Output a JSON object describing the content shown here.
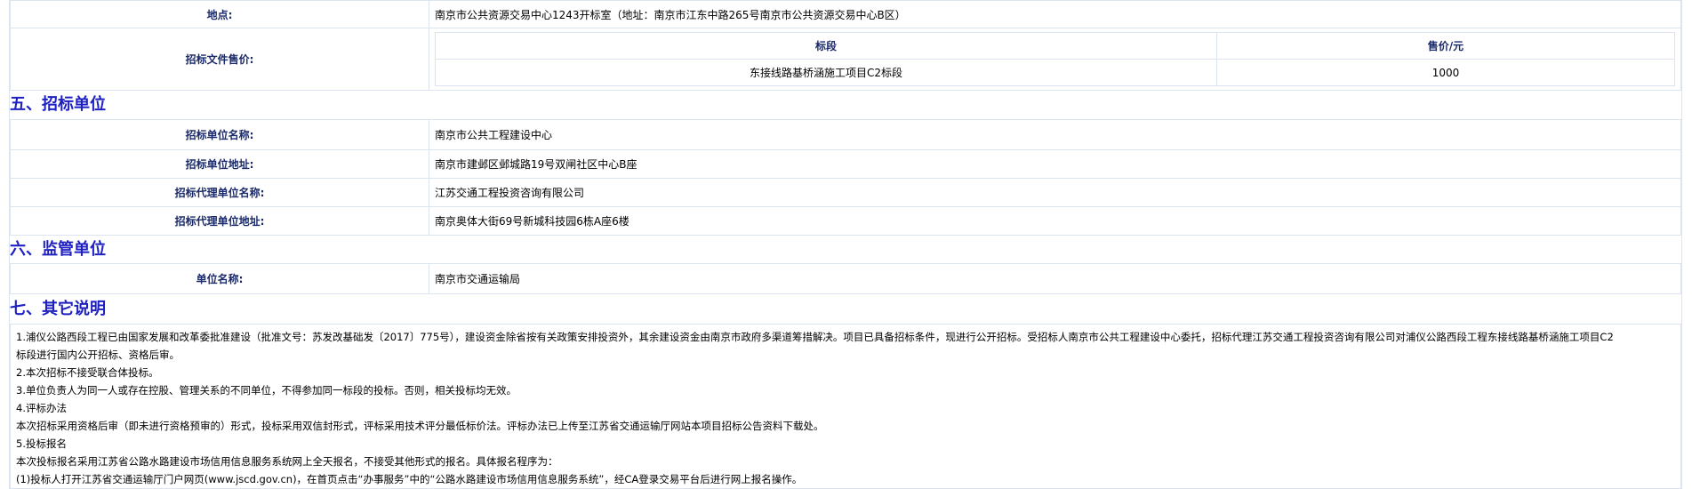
{
  "top_rows": [
    {
      "label": "地点:",
      "value": "南京市公共资源交易中心1243开标室（地址：南京市江东中路265号南京市公共资源交易中心B区）"
    }
  ],
  "price": {
    "label": "招标文件售价:",
    "headers": [
      "标段",
      "售价/元"
    ],
    "rows": [
      [
        "东接线路基桥涵施工项目C2标段",
        "1000"
      ]
    ]
  },
  "section5": {
    "title": "五、招标单位",
    "rows": [
      {
        "label": "招标单位名称:",
        "value": "南京市公共工程建设中心"
      },
      {
        "label": "招标单位地址:",
        "value": "南京市建邺区邺城路19号双闸社区中心B座"
      },
      {
        "label": "招标代理单位名称:",
        "value": "江苏交通工程投资咨询有限公司"
      },
      {
        "label": "招标代理单位地址:",
        "value": "南京奥体大街69号新城科技园6栋A座6楼"
      }
    ]
  },
  "section6": {
    "title": "六、监管单位",
    "rows": [
      {
        "label": "单位名称:",
        "value": "南京市交通运输局"
      }
    ]
  },
  "section7": {
    "title": "七、其它说明",
    "lines": [
      "1.浦仪公路西段工程已由国家发展和改革委批准建设（批准文号：苏发改基础发〔2017〕775号），建设资金除省按有关政策安排投资外，其余建设资金由南京市政府多渠道筹措解决。项目已具备招标条件，现进行公开招标。受招标人南京市公共工程建设中心委托，招标代理江苏交通工程投资咨询有限公司对浦仪公路西段工程东接线路基桥涵施工项目C2",
      "标段进行国内公开招标、资格后审。",
      "2.本次招标不接受联合体投标。",
      "3.单位负责人为同一人或存在控股、管理关系的不同单位，不得参加同一标段的投标。否则，相关投标均无效。",
      "4.评标办法",
      "本次招标采用资格后审（即未进行资格预审的）形式，投标采用双信封形式，评标采用技术评分最低标价法。评标办法已上传至江苏省交通运输厅网站本项目招标公告资料下载处。",
      "5.投标报名",
      "本次投标报名采用江苏省公路水路建设市场信用信息服务系统网上全天报名，不接受其他形式的报名。具体报名程序为：",
      "(1)投标人打开江苏省交通运输厅门户网页(www.jscd.gov.cn)，在首页点击“办事服务”中的“公路水路建设市场信用信息服务系统”，经CA登录交易平台后进行网上报名操作。"
    ]
  }
}
